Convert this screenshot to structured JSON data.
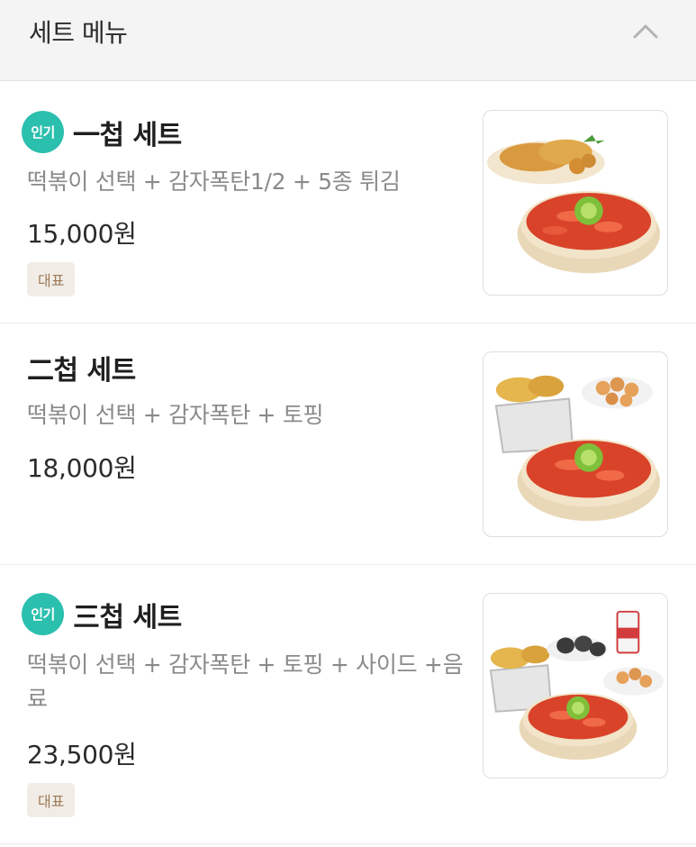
{
  "header": {
    "title": "세트 메뉴",
    "collapse_icon": "chevron-up-icon"
  },
  "badge_text": "인기",
  "items": [
    {
      "name": "一첩 세트",
      "popular": true,
      "description": "떡볶이 선택 + 감자폭탄1/2 + 5종 튀김",
      "price": "15,000원",
      "tag": "대표"
    },
    {
      "name": "二첩 세트",
      "popular": false,
      "description": "떡볶이 선택 + 감자폭탄 + 토핑",
      "price": "18,000원",
      "tag": ""
    },
    {
      "name": "三첩 세트",
      "popular": true,
      "description": "떡볶이 선택 + 감자폭탄 + 토핑 + 사이드 +음료",
      "price": "23,500원",
      "tag": "대표"
    }
  ],
  "colors": {
    "popular_badge": "#2bbfae",
    "tag_bg": "#f1ece6",
    "tag_text": "#9d7b5a",
    "header_bg": "#f4f4f4"
  }
}
